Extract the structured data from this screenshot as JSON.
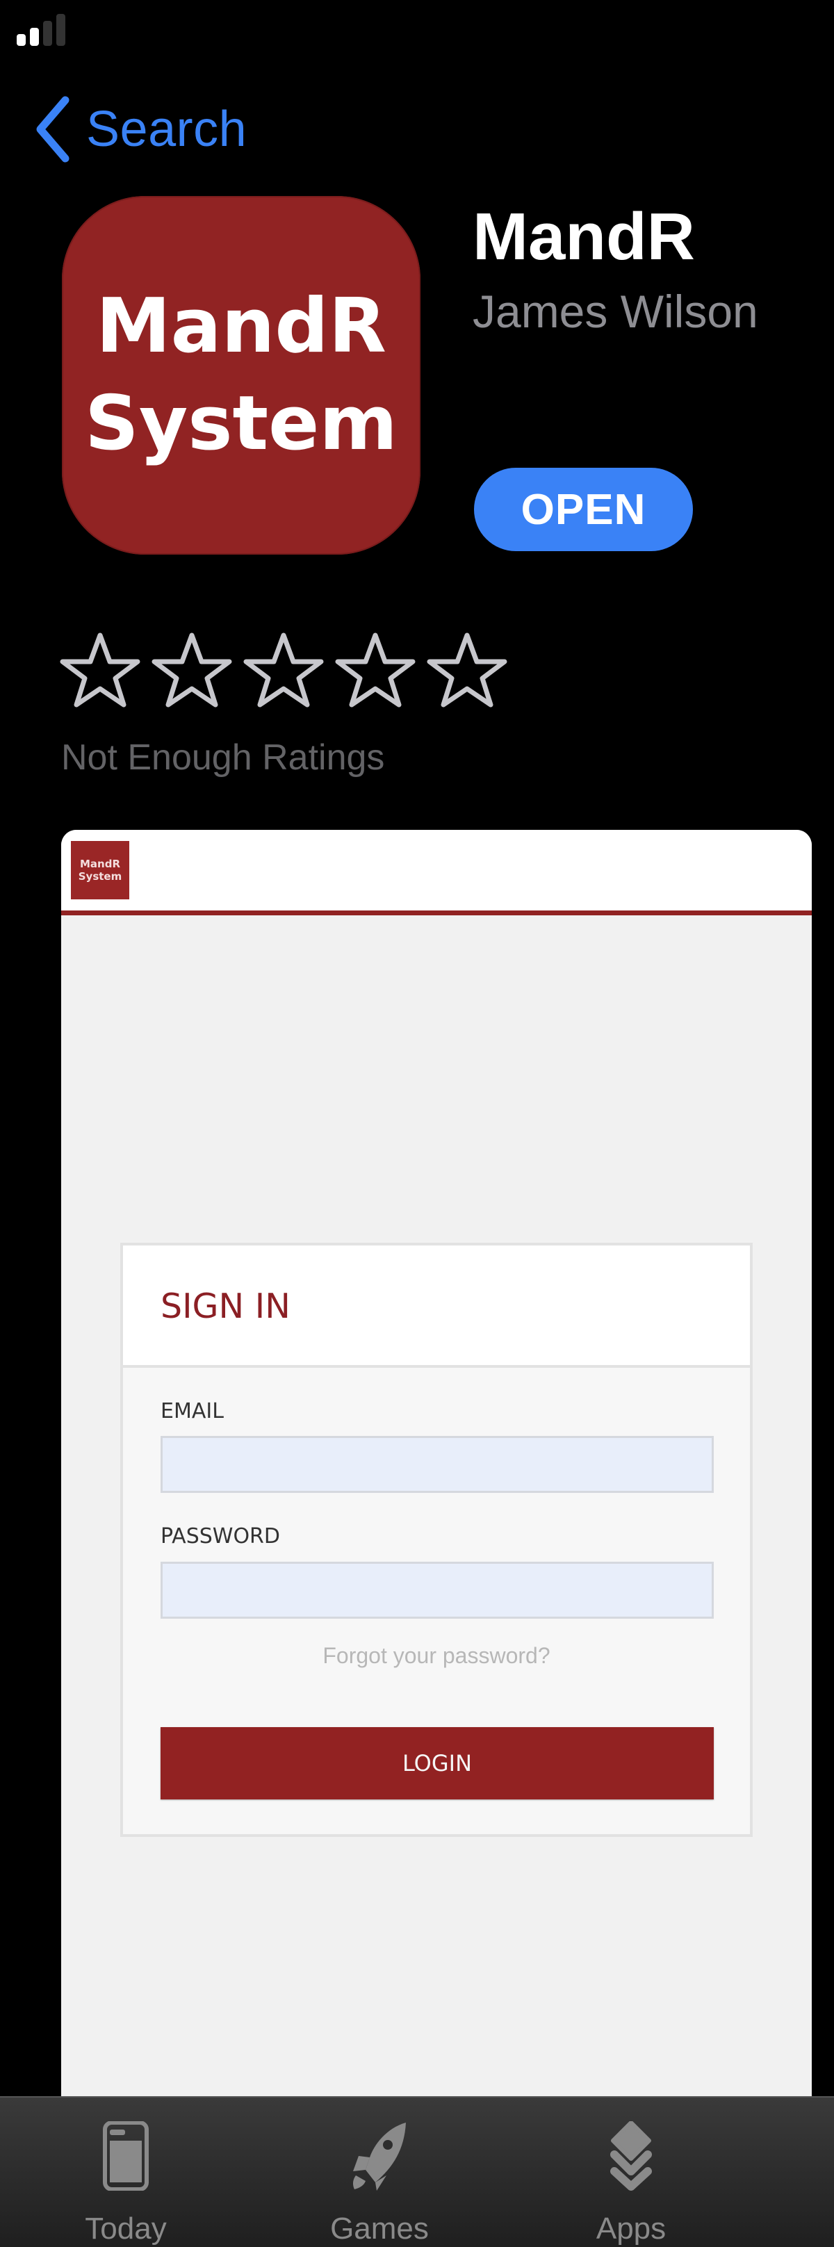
{
  "status_bar": {
    "signal_bars_active": 2,
    "signal_bars_total": 4
  },
  "nav": {
    "back_label": "Search"
  },
  "app": {
    "icon_text_line1": "MandR",
    "icon_text_line2": "System",
    "title": "MandR",
    "developer": "James Wilson",
    "action_label": "OPEN"
  },
  "ratings": {
    "stars_filled": 0,
    "stars_total": 5,
    "note": "Not Enough Ratings"
  },
  "screenshot": {
    "logo_line1": "MandR",
    "logo_line2": "System",
    "signin_title": "SIGN IN",
    "email_label": "EMAIL",
    "email_value": "",
    "password_label": "PASSWORD",
    "password_value": "",
    "forgot_link": "Forgot your password?",
    "login_label": "LOGIN"
  },
  "tabbar": {
    "items": [
      {
        "label": "Today",
        "icon": "today-icon"
      },
      {
        "label": "Games",
        "icon": "rocket-icon"
      },
      {
        "label": "Apps",
        "icon": "stack-icon"
      }
    ]
  },
  "colors": {
    "accent_blue": "#3a82f6",
    "brand_red": "#912323",
    "secondary_text": "#8e8e93"
  }
}
